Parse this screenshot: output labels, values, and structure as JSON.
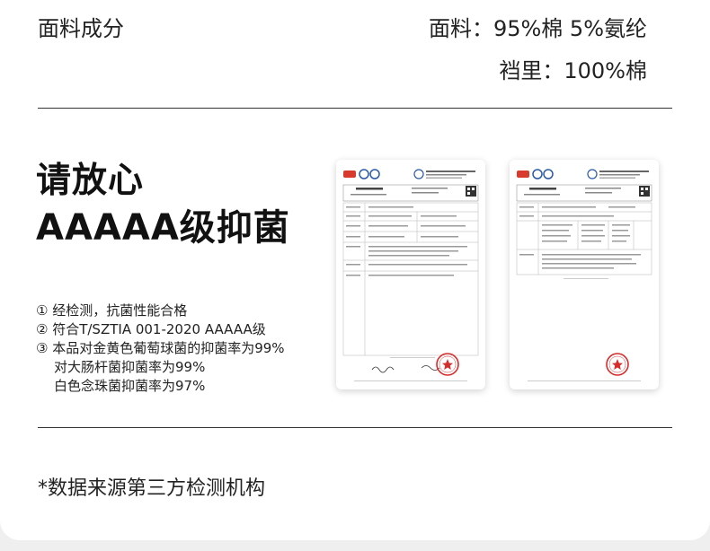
{
  "fabric": {
    "label": "面料成分",
    "main": "面料：95%棉 5%氨纶",
    "lining": "裆里：100%棉"
  },
  "headline": {
    "line1": "请放心",
    "line2": "AAAAA级抑菌"
  },
  "features": [
    "① 经检测，抗菌性能合格",
    "② 符合T/SZTIA 001-2020 AAAAA级",
    "③ 本品对金黄色葡萄球菌的抑菌率为99%"
  ],
  "features_extra": [
    "对大肠杆菌抑菌率为99%",
    "白色念珠菌抑菌率为97%"
  ],
  "note": "*数据来源第三方检测机构",
  "colors": {
    "seal": "#d62c2c",
    "logo_red": "#d83a2e",
    "logo_blue": "#2a59a8"
  }
}
